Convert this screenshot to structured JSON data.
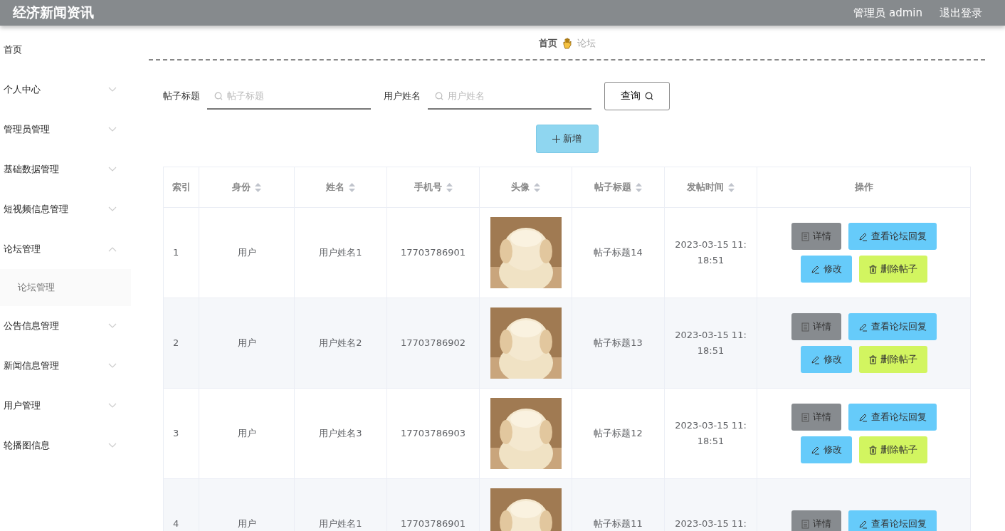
{
  "header": {
    "title": "经济新闻资讯",
    "user": "管理员 admin",
    "logout": "退出登录"
  },
  "sidebar": {
    "items": [
      {
        "label": "首页",
        "kind": "link"
      },
      {
        "label": "个人中心",
        "kind": "menu",
        "expanded": false
      },
      {
        "label": "管理员管理",
        "kind": "menu",
        "expanded": false
      },
      {
        "label": "基础数据管理",
        "kind": "menu",
        "expanded": false
      },
      {
        "label": "短视频信息管理",
        "kind": "menu",
        "expanded": false
      },
      {
        "label": "论坛管理",
        "kind": "menu",
        "expanded": true,
        "children": [
          {
            "label": "论坛管理"
          }
        ]
      },
      {
        "label": "公告信息管理",
        "kind": "menu",
        "expanded": false
      },
      {
        "label": "新闻信息管理",
        "kind": "menu",
        "expanded": false
      },
      {
        "label": "用户管理",
        "kind": "menu",
        "expanded": false
      },
      {
        "label": "轮播图信息",
        "kind": "menu",
        "expanded": false
      }
    ]
  },
  "breadcrumb": {
    "home": "首页",
    "current": "论坛"
  },
  "search": {
    "fields": [
      {
        "label": "帖子标题",
        "placeholder": "帖子标题"
      },
      {
        "label": "用户姓名",
        "placeholder": "用户姓名"
      }
    ],
    "button": "查询"
  },
  "add_button": "新增",
  "table": {
    "columns": [
      {
        "label": "索引",
        "sortable": false
      },
      {
        "label": "身份",
        "sortable": true
      },
      {
        "label": "姓名",
        "sortable": true
      },
      {
        "label": "手机号",
        "sortable": true
      },
      {
        "label": "头像",
        "sortable": true
      },
      {
        "label": "帖子标题",
        "sortable": true
      },
      {
        "label": "发帖时间",
        "sortable": true
      },
      {
        "label": "操作",
        "sortable": false
      }
    ],
    "rows": [
      {
        "index": "1",
        "role": "用户",
        "name": "用户姓名1",
        "phone": "17703786901",
        "title": "帖子标题14",
        "time": "2023-03-15 11:18:51",
        "actions": [
          {
            "kind": "detail",
            "label": "详情"
          },
          {
            "kind": "replies",
            "label": "查看论坛回复"
          },
          {
            "kind": "edit",
            "label": "修改"
          },
          {
            "kind": "delete",
            "label": "删除帖子"
          }
        ]
      },
      {
        "index": "2",
        "role": "用户",
        "name": "用户姓名2",
        "phone": "17703786902",
        "title": "帖子标题13",
        "time": "2023-03-15 11:18:51",
        "actions": [
          {
            "kind": "detail",
            "label": "详情"
          },
          {
            "kind": "replies",
            "label": "查看论坛回复"
          },
          {
            "kind": "edit",
            "label": "修改"
          },
          {
            "kind": "delete",
            "label": "删除帖子"
          }
        ]
      },
      {
        "index": "3",
        "role": "用户",
        "name": "用户姓名3",
        "phone": "17703786903",
        "title": "帖子标题12",
        "time": "2023-03-15 11:18:51",
        "actions": [
          {
            "kind": "detail",
            "label": "详情"
          },
          {
            "kind": "replies",
            "label": "查看论坛回复"
          },
          {
            "kind": "edit",
            "label": "修改"
          },
          {
            "kind": "delete",
            "label": "删除帖子"
          }
        ]
      },
      {
        "index": "4",
        "role": "用户",
        "name": "用户姓名1",
        "phone": "17703786901",
        "title": "帖子标题11",
        "time": "2023-03-15 11:",
        "actions": [
          {
            "kind": "detail",
            "label": "详情"
          },
          {
            "kind": "replies",
            "label": "查看论坛回复"
          }
        ]
      }
    ]
  }
}
